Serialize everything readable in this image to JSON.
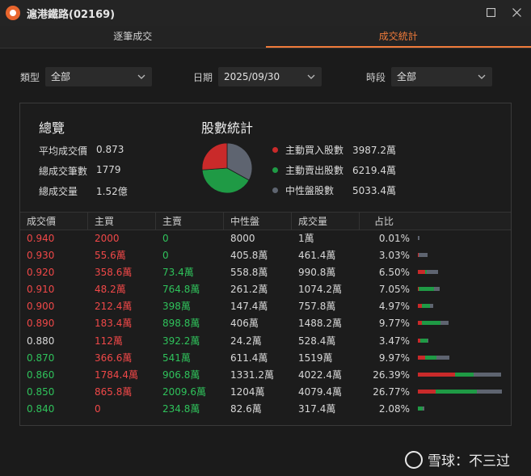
{
  "window": {
    "title": "滬港鐵路(02169)"
  },
  "tabs": [
    {
      "label": "逐筆成交",
      "active": false
    },
    {
      "label": "成交統計",
      "active": true
    }
  ],
  "filters": {
    "type": {
      "label": "類型",
      "value": "全部"
    },
    "date": {
      "label": "日期",
      "value": "2025/09/30"
    },
    "period": {
      "label": "時段",
      "value": "全部"
    }
  },
  "overview": {
    "title": "總覽",
    "items": [
      {
        "label": "平均成交價",
        "value": "0.873"
      },
      {
        "label": "總成交筆數",
        "value": "1779"
      },
      {
        "label": "總成交量",
        "value": "1.52億"
      }
    ]
  },
  "share_stats": {
    "title": "股數統計",
    "items": [
      {
        "label": "主動買入股數",
        "value": "3987.2萬",
        "shares": 3987.2,
        "color": "#c92a2a"
      },
      {
        "label": "主動賣出股數",
        "value": "6219.4萬",
        "shares": 6219.4,
        "color": "#1f9a45"
      },
      {
        "label": "中性盤股數",
        "value": "5033.4萬",
        "shares": 5033.4,
        "color": "#5e6470"
      }
    ]
  },
  "table": {
    "headers": [
      "成交價",
      "主買",
      "主賣",
      "中性盤",
      "成交量",
      "占比"
    ],
    "rows": [
      {
        "price": "0.940",
        "pc": "red",
        "buy": "2000",
        "sell": "0",
        "neutral": "8000",
        "volume": "1萬",
        "pct": "0.01%",
        "share": 0.0001,
        "b": 0.2,
        "s": 0.0,
        "n": 0.8
      },
      {
        "price": "0.930",
        "pc": "red",
        "buy": "55.6萬",
        "sell": "0",
        "neutral": "405.8萬",
        "volume": "461.4萬",
        "pct": "3.03%",
        "share": 0.0303,
        "b": 0.12,
        "s": 0.0,
        "n": 0.88
      },
      {
        "price": "0.920",
        "pc": "red",
        "buy": "358.6萬",
        "sell": "73.4萬",
        "neutral": "558.8萬",
        "volume": "990.8萬",
        "pct": "6.50%",
        "share": 0.065,
        "b": 0.362,
        "s": 0.074,
        "n": 0.564
      },
      {
        "price": "0.910",
        "pc": "red",
        "buy": "48.2萬",
        "sell": "764.8萬",
        "neutral": "261.2萬",
        "volume": "1074.2萬",
        "pct": "7.05%",
        "share": 0.0705,
        "b": 0.045,
        "s": 0.712,
        "n": 0.243
      },
      {
        "price": "0.900",
        "pc": "red",
        "buy": "212.4萬",
        "sell": "398萬",
        "neutral": "147.4萬",
        "volume": "757.8萬",
        "pct": "4.97%",
        "share": 0.0497,
        "b": 0.28,
        "s": 0.525,
        "n": 0.195
      },
      {
        "price": "0.890",
        "pc": "red",
        "buy": "183.4萬",
        "sell": "898.8萬",
        "neutral": "406萬",
        "volume": "1488.2萬",
        "pct": "9.77%",
        "share": 0.0977,
        "b": 0.123,
        "s": 0.604,
        "n": 0.273
      },
      {
        "price": "0.880",
        "pc": "white",
        "buy": "112萬",
        "sell": "392.2萬",
        "neutral": "24.2萬",
        "volume": "528.4萬",
        "pct": "3.47%",
        "share": 0.0347,
        "b": 0.212,
        "s": 0.742,
        "n": 0.046
      },
      {
        "price": "0.870",
        "pc": "green",
        "buy": "366.6萬",
        "sell": "541萬",
        "neutral": "611.4萬",
        "volume": "1519萬",
        "pct": "9.97%",
        "share": 0.0997,
        "b": 0.241,
        "s": 0.356,
        "n": 0.403
      },
      {
        "price": "0.860",
        "pc": "green",
        "buy": "1784.4萬",
        "sell": "906.8萬",
        "neutral": "1331.2萬",
        "volume": "4022.4萬",
        "pct": "26.39%",
        "share": 0.2639,
        "b": 0.444,
        "s": 0.225,
        "n": 0.331
      },
      {
        "price": "0.850",
        "pc": "green",
        "buy": "865.8萬",
        "sell": "2009.6萬",
        "neutral": "1204萬",
        "volume": "4079.4萬",
        "pct": "26.77%",
        "share": 0.2677,
        "b": 0.212,
        "s": 0.493,
        "n": 0.295
      },
      {
        "price": "0.840",
        "pc": "green",
        "buy": "0",
        "sell": "234.8萬",
        "neutral": "82.6萬",
        "volume": "317.4萬",
        "pct": "2.08%",
        "share": 0.0208,
        "b": 0.0,
        "s": 0.74,
        "n": 0.26
      }
    ]
  },
  "watermark": {
    "text": "雪球：不三过"
  },
  "colors": {
    "accent": "#ef7a3a",
    "up": "#f04848",
    "down": "#2fc25b",
    "neutral_bar": "#5e6470"
  }
}
